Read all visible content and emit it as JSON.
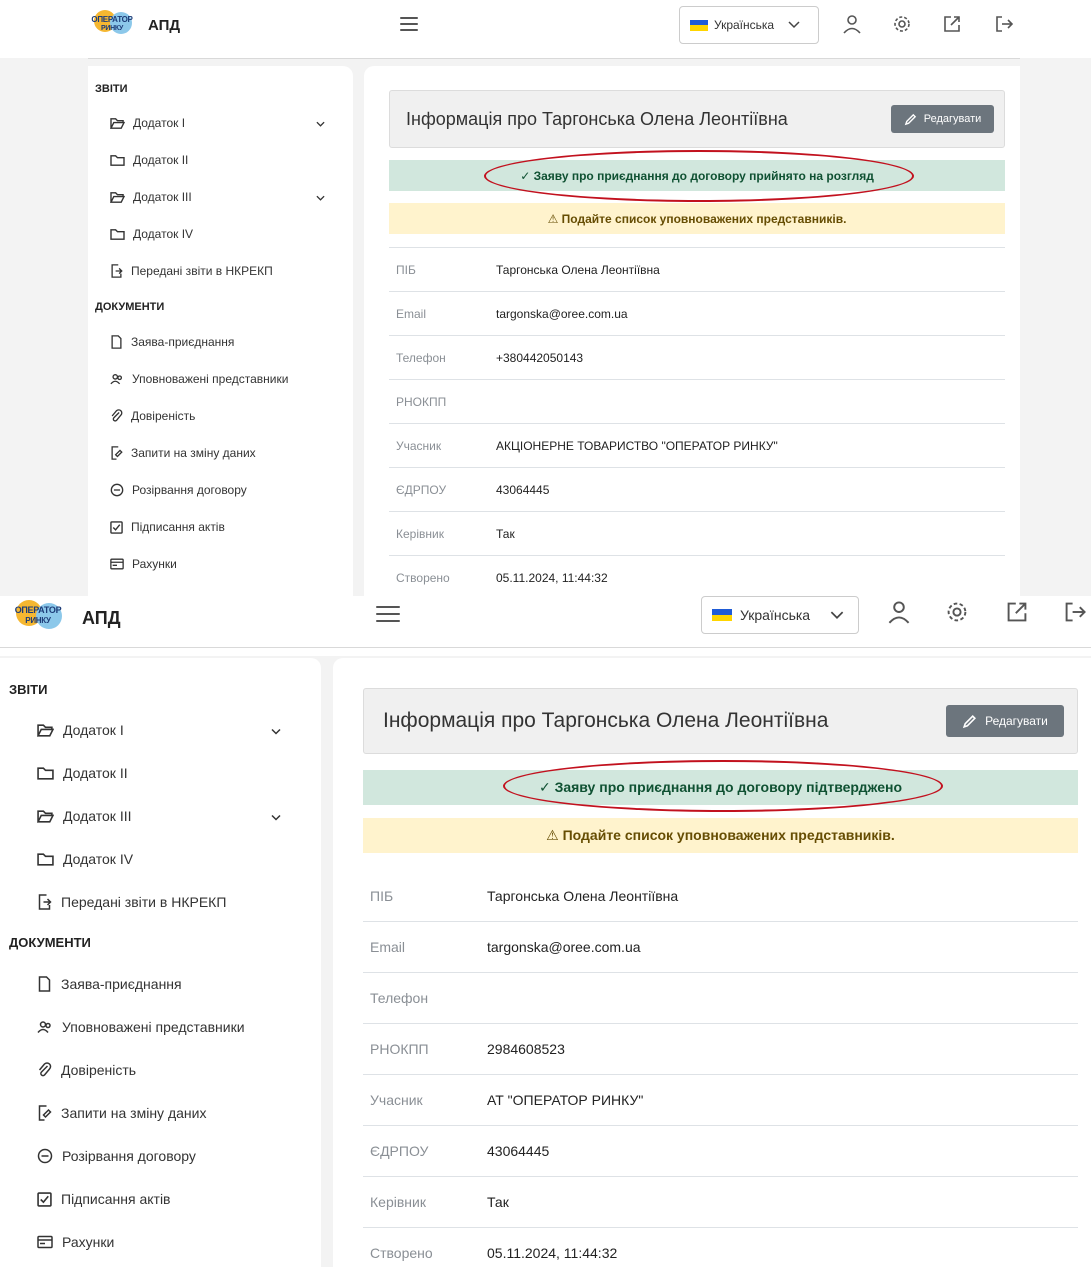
{
  "screens": [
    {
      "app": {
        "logo_line1": "ОПЕРАТОР",
        "logo_line2": "РИНКУ",
        "title": "АПД"
      },
      "header": {
        "language": "Українська",
        "icons": [
          "menu-icon",
          "user-icon",
          "settings-icon",
          "external-link-icon",
          "logout-icon"
        ]
      },
      "sidebar": {
        "section_reports": "ЗВІТИ",
        "section_documents": "ДОКУМЕНТИ",
        "reports": [
          {
            "label": "Додаток I",
            "icon": "folder-open-icon",
            "expandable": true
          },
          {
            "label": "Додаток II",
            "icon": "folder-icon",
            "expandable": false
          },
          {
            "label": "Додаток III",
            "icon": "folder-open-icon",
            "expandable": true
          },
          {
            "label": "Додаток IV",
            "icon": "folder-icon",
            "expandable": false
          },
          {
            "label": "Передані звіти в НКРЕКП",
            "icon": "file-export-icon",
            "expandable": false
          }
        ],
        "documents": [
          {
            "label": "Заява-приєднання",
            "icon": "file-icon"
          },
          {
            "label": "Уповноважені представники",
            "icon": "users-icon"
          },
          {
            "label": "Довіреність",
            "icon": "paperclip-icon"
          },
          {
            "label": "Запити на зміну даних",
            "icon": "file-edit-icon"
          },
          {
            "label": "Розірвання договору",
            "icon": "minus-circle-icon"
          },
          {
            "label": "Підписання актів",
            "icon": "check-square-icon"
          },
          {
            "label": "Рахунки",
            "icon": "card-icon"
          }
        ]
      },
      "main": {
        "title": "Інформація про Таргонська Олена Леонтіївна",
        "edit_label": "Редагувати",
        "success_alert": "✓ Заяву про приєднання до договору прийнято на розгляд",
        "warning_alert": "⚠ Подайте список уповноважених представників.",
        "rows": [
          {
            "label": "ПІБ",
            "value": "Таргонська Олена Леонтіївна"
          },
          {
            "label": "Email",
            "value": "targonska@oree.com.ua"
          },
          {
            "label": "Телефон",
            "value": "+380442050143"
          },
          {
            "label": "РНОКПП",
            "value": ""
          },
          {
            "label": "Учасник",
            "value": "АКЦІОНЕРНЕ ТОВАРИСТВО \"ОПЕРАТОР РИНКУ\""
          },
          {
            "label": "ЄДРПОУ",
            "value": "43064445"
          },
          {
            "label": "Керівник",
            "value": "Так"
          },
          {
            "label": "Створено",
            "value": "05.11.2024, 11:44:32"
          }
        ]
      }
    },
    {
      "app": {
        "logo_line1": "ОПЕРАТОР",
        "logo_line2": "РИНКУ",
        "title": "АПД"
      },
      "header": {
        "language": "Українська",
        "icons": [
          "menu-icon",
          "user-icon",
          "settings-icon",
          "external-link-icon",
          "logout-icon"
        ]
      },
      "sidebar": {
        "section_reports": "ЗВІТИ",
        "section_documents": "ДОКУМЕНТИ",
        "reports": [
          {
            "label": "Додаток I",
            "icon": "folder-open-icon",
            "expandable": true
          },
          {
            "label": "Додаток II",
            "icon": "folder-icon",
            "expandable": false
          },
          {
            "label": "Додаток III",
            "icon": "folder-open-icon",
            "expandable": true
          },
          {
            "label": "Додаток IV",
            "icon": "folder-icon",
            "expandable": false
          },
          {
            "label": "Передані звіти в НКРЕКП",
            "icon": "file-export-icon",
            "expandable": false
          }
        ],
        "documents": [
          {
            "label": "Заява-приєднання",
            "icon": "file-icon"
          },
          {
            "label": "Уповноважені представники",
            "icon": "users-icon"
          },
          {
            "label": "Довіреність",
            "icon": "paperclip-icon"
          },
          {
            "label": "Запити на зміну даних",
            "icon": "file-edit-icon"
          },
          {
            "label": "Розірвання договору",
            "icon": "minus-circle-icon"
          },
          {
            "label": "Підписання актів",
            "icon": "check-square-icon"
          },
          {
            "label": "Рахунки",
            "icon": "card-icon"
          }
        ]
      },
      "main": {
        "title": "Інформація про Таргонська Олена Леонтіївна",
        "edit_label": "Редагувати",
        "success_alert": "✓ Заяву про приєднання до договору підтверджено",
        "warning_alert": "⚠ Подайте список уповноважених представників.",
        "rows": [
          {
            "label": "ПІБ",
            "value": "Таргонська Олена Леонтіївна"
          },
          {
            "label": "Email",
            "value": "targonska@oree.com.ua"
          },
          {
            "label": "Телефон",
            "value": ""
          },
          {
            "label": "РНОКПП",
            "value": "2984608523"
          },
          {
            "label": "Учасник",
            "value": "АТ \"ОПЕРАТОР РИНКУ\""
          },
          {
            "label": "ЄДРПОУ",
            "value": "43064445"
          },
          {
            "label": "Керівник",
            "value": "Так"
          },
          {
            "label": "Створено",
            "value": "05.11.2024, 11:44:32"
          }
        ]
      }
    }
  ]
}
